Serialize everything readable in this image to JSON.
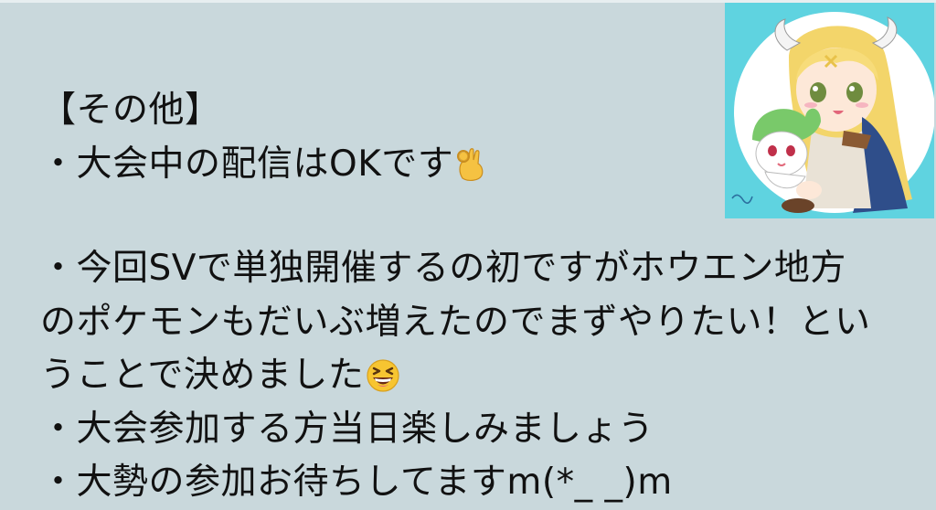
{
  "message": {
    "lines": [
      "【その他】",
      "・大会中の配信はOKです",
      "",
      "・今回SVで単独開催するの初ですがホウエン地方",
      "のポケモンもだいぶ増えたのでまずやりたい！とい",
      "うことで決めました",
      "・大会参加する方当日楽しみましょう",
      "・大勢の参加お待ちしてますm(*_ _)m"
    ]
  },
  "icons": {
    "ok_hand": "ok-hand-emoji",
    "laughing": "laughing-emoji",
    "avatar": "avatar-illustration"
  },
  "colors": {
    "background": "#c9d8dc",
    "avatar_bg": "#5fd3e0",
    "text": "#111111"
  }
}
